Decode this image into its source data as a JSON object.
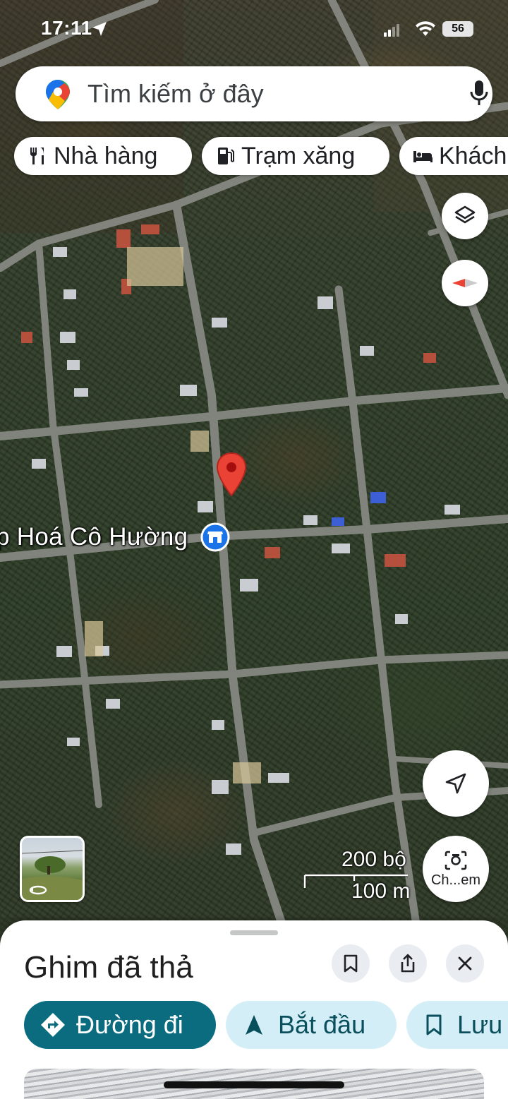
{
  "status_bar": {
    "time": "17:11",
    "battery": "56"
  },
  "search": {
    "placeholder": "Tìm kiếm ở đây"
  },
  "chips": [
    {
      "label": "Nhà hàng",
      "icon": "restaurant-icon"
    },
    {
      "label": "Trạm xăng",
      "icon": "gas-station-icon"
    },
    {
      "label": "Khách",
      "icon": "hotel-icon"
    }
  ],
  "map": {
    "place_label": "p Hoá Cô Hường",
    "place_icon": "shop-icon",
    "scale_imperial": "200 bộ",
    "scale_metric": "100 m",
    "pin_color": "#ea4335"
  },
  "map_buttons": {
    "layers": "layers-icon",
    "compass": "compass-icon",
    "my_location": "navigation-arrow-icon",
    "camera_label": "Ch...em"
  },
  "sheet": {
    "title": "Ghim đã thả",
    "actions": {
      "directions": "Đường đi",
      "start": "Bắt đầu",
      "save": "Lưu"
    }
  },
  "colors": {
    "accent": "#0b6c80",
    "pill_bg": "#d3eef7",
    "pill_text": "#0a4f5c"
  }
}
